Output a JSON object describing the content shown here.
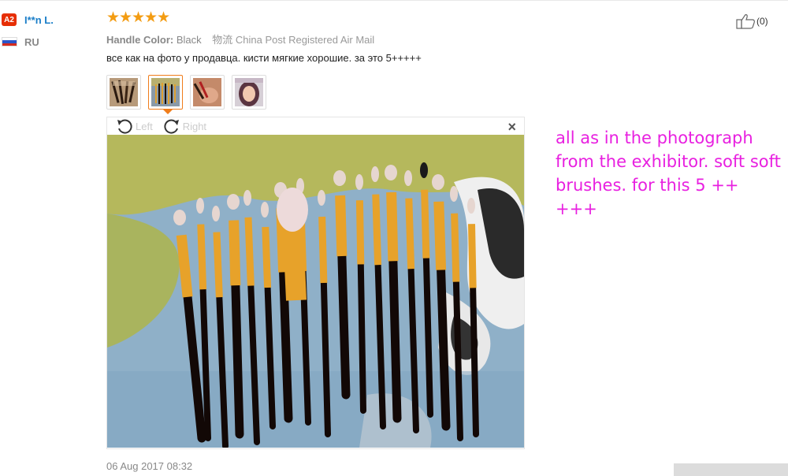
{
  "user": {
    "level_badge": "A2",
    "name": "I**n L.",
    "country_code": "RU",
    "flag_colors": [
      "#ffffff",
      "#2a55c9",
      "#d52b1e"
    ]
  },
  "review": {
    "rating": 5,
    "rating_max": 5,
    "star_color": "#f39c12",
    "handle_color_label": "Handle Color:",
    "handle_color_value": "Black",
    "shipping": "物流 China Post Registered Air Mail",
    "content": "все как на фото у продавца. кисти мягкие хорошие. за это 5+++++",
    "thumbnails": [
      "brushes-thumb-1",
      "brushes-thumb-2",
      "hand-thumb",
      "portrait-thumb"
    ],
    "active_thumbnail": 1,
    "viewer": {
      "rotate_left_label": "Left",
      "rotate_right_label": "Right",
      "close_icon": "close-icon"
    },
    "date": "06 Aug 2017 08:32"
  },
  "helpful": {
    "icon": "thumbs-up-icon",
    "count": "(0)"
  },
  "translation": "all as in the photograph from the exhibitor. soft soft brushes. for this 5 ++ +++",
  "colors": {
    "username": "#1a7ec8",
    "badge": "#e62e04",
    "active_border": "#f07d1b",
    "translation": "#e820e0"
  }
}
